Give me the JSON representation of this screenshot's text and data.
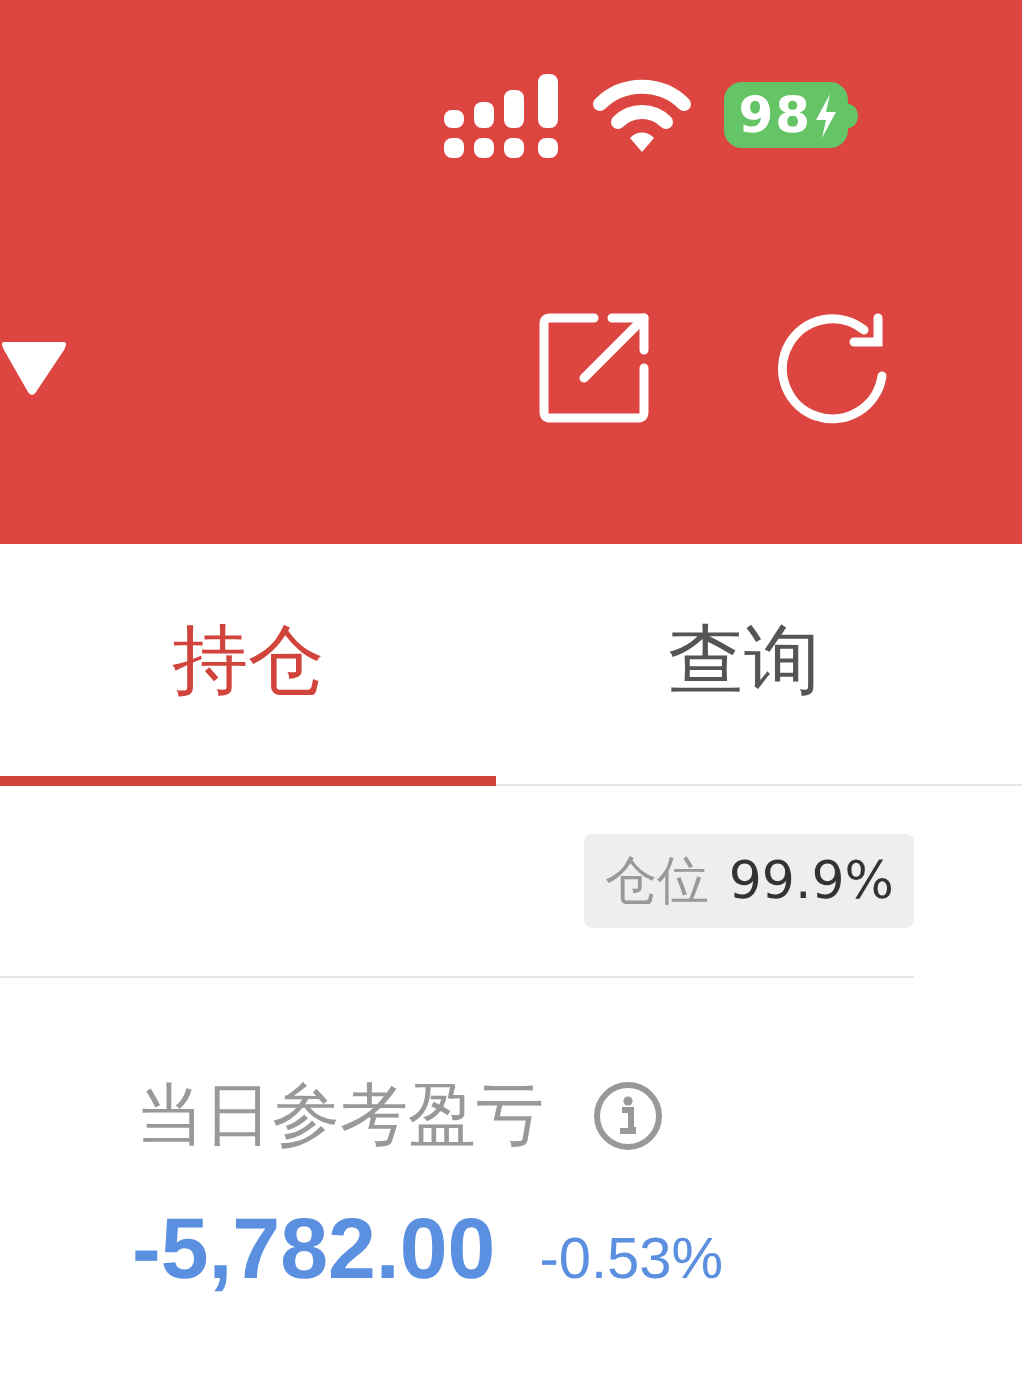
{
  "status_bar": {
    "battery": "98"
  },
  "tabs": [
    {
      "label": "持仓",
      "selected": true
    },
    {
      "label": "查询",
      "selected": false
    }
  ],
  "position_badge": {
    "label": "仓位",
    "value": "99.9%"
  },
  "daily_pnl": {
    "label": "当日参考盈亏",
    "value": "-5,782.00",
    "percent": "-0.53%"
  }
}
